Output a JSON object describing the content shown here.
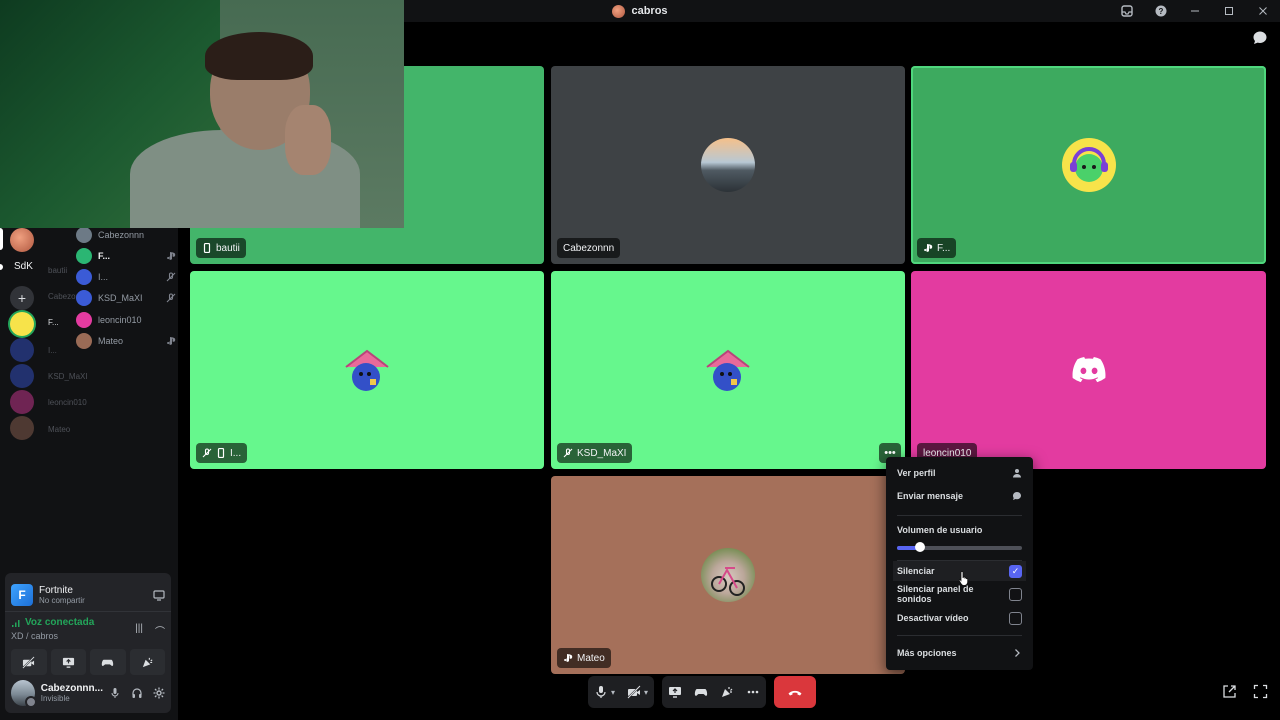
{
  "titlebar": {
    "title": "cabros"
  },
  "sidebar": {
    "server_label": "SdK",
    "ghost_names": [
      "bautii",
      "Cabezonnn",
      "F...",
      "I...",
      "KSD_MaXI",
      "leoncin010",
      "Mateo"
    ],
    "voice_users": [
      {
        "name": "Cabezonnn",
        "color": "#6d7a86",
        "right_icon": ""
      },
      {
        "name": "F...",
        "color": "#2bb673",
        "right_icon": "playstation-icon",
        "highlight": true
      },
      {
        "name": "I...",
        "color": "#3b5bd6",
        "right_icon": "mic-off-icon"
      },
      {
        "name": "KSD_MaXI",
        "color": "#3b5bd6",
        "right_icon": "mic-off-icon"
      },
      {
        "name": "leoncin010",
        "color": "#e33ba0",
        "right_icon": ""
      },
      {
        "name": "Mateo",
        "color": "#9a6b56",
        "right_icon": "playstation-icon"
      }
    ]
  },
  "activity": {
    "game_name": "Fortnite",
    "game_sub": "No compartir",
    "voice_status": "Voz conectada",
    "voice_channel": "XD / cabros"
  },
  "user": {
    "name": "Cabezonnn...",
    "status": "Invisible"
  },
  "tiles": [
    {
      "name": "bautii",
      "bg": "#43b56a",
      "icon": "phone-icon"
    },
    {
      "name": "Cabezonnn",
      "bg": "#3e4245",
      "icon": ""
    },
    {
      "name": "F...",
      "bg": "#3daa5f",
      "icon": "playstation-icon"
    },
    {
      "name": "I...",
      "bg": "#66f78d",
      "icon": "mic-off-phone"
    },
    {
      "name": "KSD_MaXI",
      "bg": "#66f78d",
      "icon": "mic-off-icon"
    },
    {
      "name": "leoncin010",
      "bg": "#e33ba0",
      "icon": ""
    },
    {
      "name": "Mateo",
      "bg": "#a5705a",
      "icon": "playstation-icon"
    }
  ],
  "context_menu": {
    "view_profile": "Ver perfil",
    "send_message": "Enviar mensaje",
    "user_volume": "Volumen de usuario",
    "volume_percent": 18,
    "mute": "Silenciar",
    "mute_checked": true,
    "mute_soundboard": "Silenciar panel de sonidos",
    "mute_soundboard_checked": false,
    "disable_video": "Desactivar vídeo",
    "disable_video_checked": false,
    "more_options": "Más opciones"
  },
  "colors": {
    "accent": "#5865f2",
    "end_call": "#da373c",
    "connected": "#23a55a"
  }
}
